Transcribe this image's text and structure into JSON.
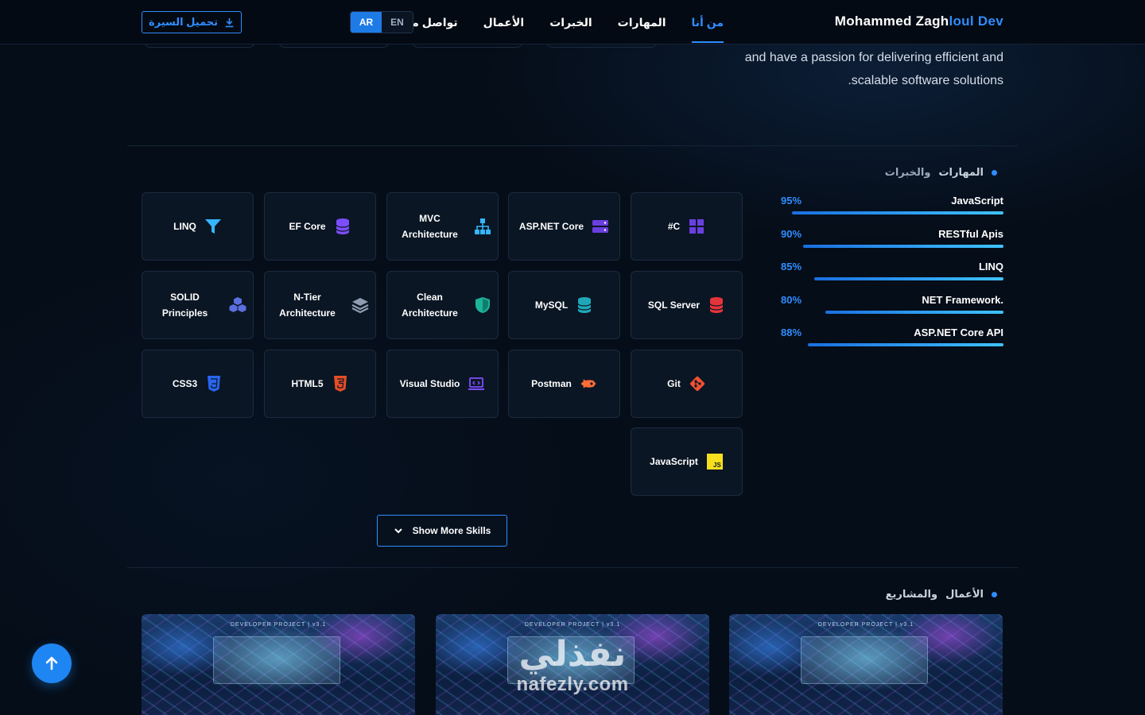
{
  "nav": {
    "brand_main": "Mohammed Zagh",
    "brand_accent": "loul Dev",
    "links": [
      "من أنا",
      "المهارات",
      "الخبرات",
      "الأعمال",
      "تواصل معي"
    ],
    "lang_en": "EN",
    "lang_ar": "AR",
    "cv_button": "تحميل السيرة"
  },
  "about": {
    "line1": "and have a passion for delivering efficient and",
    "line2": ".scalable software solutions"
  },
  "skills_section": {
    "title_a": "المهارات",
    "title_b": "والخبرات",
    "bars": [
      {
        "name": "JavaScript",
        "percent": "95%",
        "level": 95
      },
      {
        "name": "RESTful Apis",
        "percent": "90%",
        "level": 90
      },
      {
        "name": "LINQ",
        "percent": "85%",
        "level": 85
      },
      {
        "name": "NET Framework.",
        "percent": "80%",
        "level": 80
      },
      {
        "name": "ASP.NET Core API",
        "percent": "88%",
        "level": 88
      }
    ],
    "cards": {
      "csharp": "#C",
      "aspnet": "ASP.NET Core",
      "mvc": "MVC Architecture",
      "efcore": "EF Core",
      "linq": "LINQ",
      "sqlserver": "SQL Server",
      "mysql": "MySQL",
      "clean": "Clean Architecture",
      "ntier": "N-Tier Architecture",
      "solid": "SOLID Principles",
      "git": "Git",
      "postman": "Postman",
      "vs": "Visual Studio",
      "html5": "HTML5",
      "css3": "CSS3",
      "javascript": "JavaScript"
    },
    "show_more": "Show More Skills"
  },
  "projects_section": {
    "title_a": "الأعمال",
    "title_b": "والمشاريع",
    "caption": "DEVELOPER PROJECT | v3.1"
  },
  "watermark": {
    "ar": "نفذلي",
    "en": "nafezly.com"
  }
}
